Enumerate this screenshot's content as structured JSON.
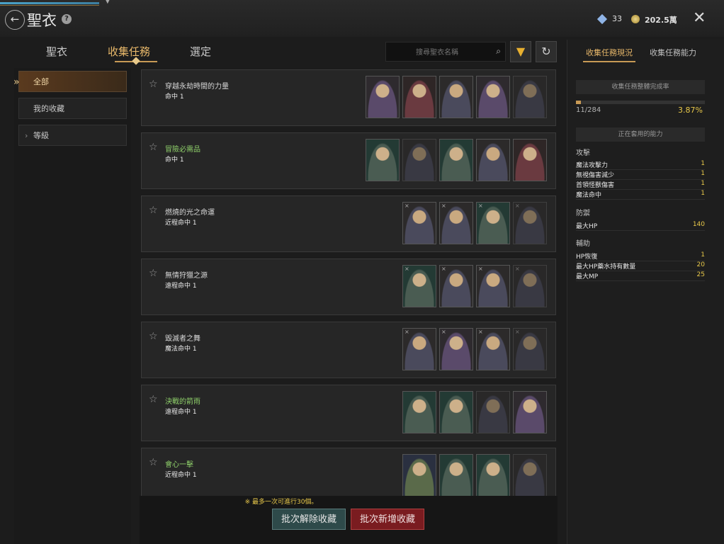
{
  "header": {
    "title": "聖衣",
    "gems": "33",
    "gold": "202.5萬"
  },
  "tabs": [
    "聖衣",
    "收集任務",
    "選定"
  ],
  "search": {
    "placeholder": "搜尋聖衣名稱"
  },
  "sidebar": {
    "items": [
      {
        "label": "全部"
      },
      {
        "label": "我的收藏"
      },
      {
        "label": "等級"
      }
    ]
  },
  "collections": [
    {
      "name": "穿越永劫時間的力量",
      "effect": "命中 1",
      "name_color": "white",
      "portraits": 5
    },
    {
      "name": "冒險必需品",
      "effect": "命中 1",
      "name_color": "green",
      "portraits": 5
    },
    {
      "name": "燃燒的光之命運",
      "effect": "近程命中 1",
      "name_color": "white",
      "portraits": 4
    },
    {
      "name": "無情狩獵之源",
      "effect": "遠程命中 1",
      "name_color": "white",
      "portraits": 4
    },
    {
      "name": "毀滅者之舞",
      "effect": "魔法命中 1",
      "name_color": "white",
      "portraits": 4
    },
    {
      "name": "決戰的箭雨",
      "effect": "遠程命中 1",
      "name_color": "green",
      "portraits": 4
    },
    {
      "name": "會心一擊",
      "effect": "近程命中 1",
      "name_color": "green",
      "portraits": 4
    }
  ],
  "bottom": {
    "note": "※ 最多一次可進行30個。",
    "cancel_label": "批次解除收藏",
    "add_label": "批次新增收藏"
  },
  "right_panel": {
    "tabs": [
      "收集任務現況",
      "收集任務能力"
    ],
    "completion_header": "收集任務整體完成率",
    "count": "11/284",
    "percent": "3.87%",
    "progress_fraction": 0.0387,
    "active_header": "正在套用的能力",
    "groups": [
      {
        "name": "攻擊",
        "stats": [
          {
            "label": "魔法攻擊力",
            "value": "1"
          },
          {
            "label": "無視傷害減少",
            "value": "1"
          },
          {
            "label": "首領怪獸傷害",
            "value": "1"
          },
          {
            "label": "魔法命中",
            "value": "1"
          }
        ]
      },
      {
        "name": "防禦",
        "stats": [
          {
            "label": "最大HP",
            "value": "140"
          }
        ]
      },
      {
        "name": "輔助",
        "stats": [
          {
            "label": "HP恢復",
            "value": "1"
          },
          {
            "label": "最大HP藥水持有數量",
            "value": "20"
          },
          {
            "label": "最大MP",
            "value": "25"
          }
        ]
      }
    ]
  }
}
